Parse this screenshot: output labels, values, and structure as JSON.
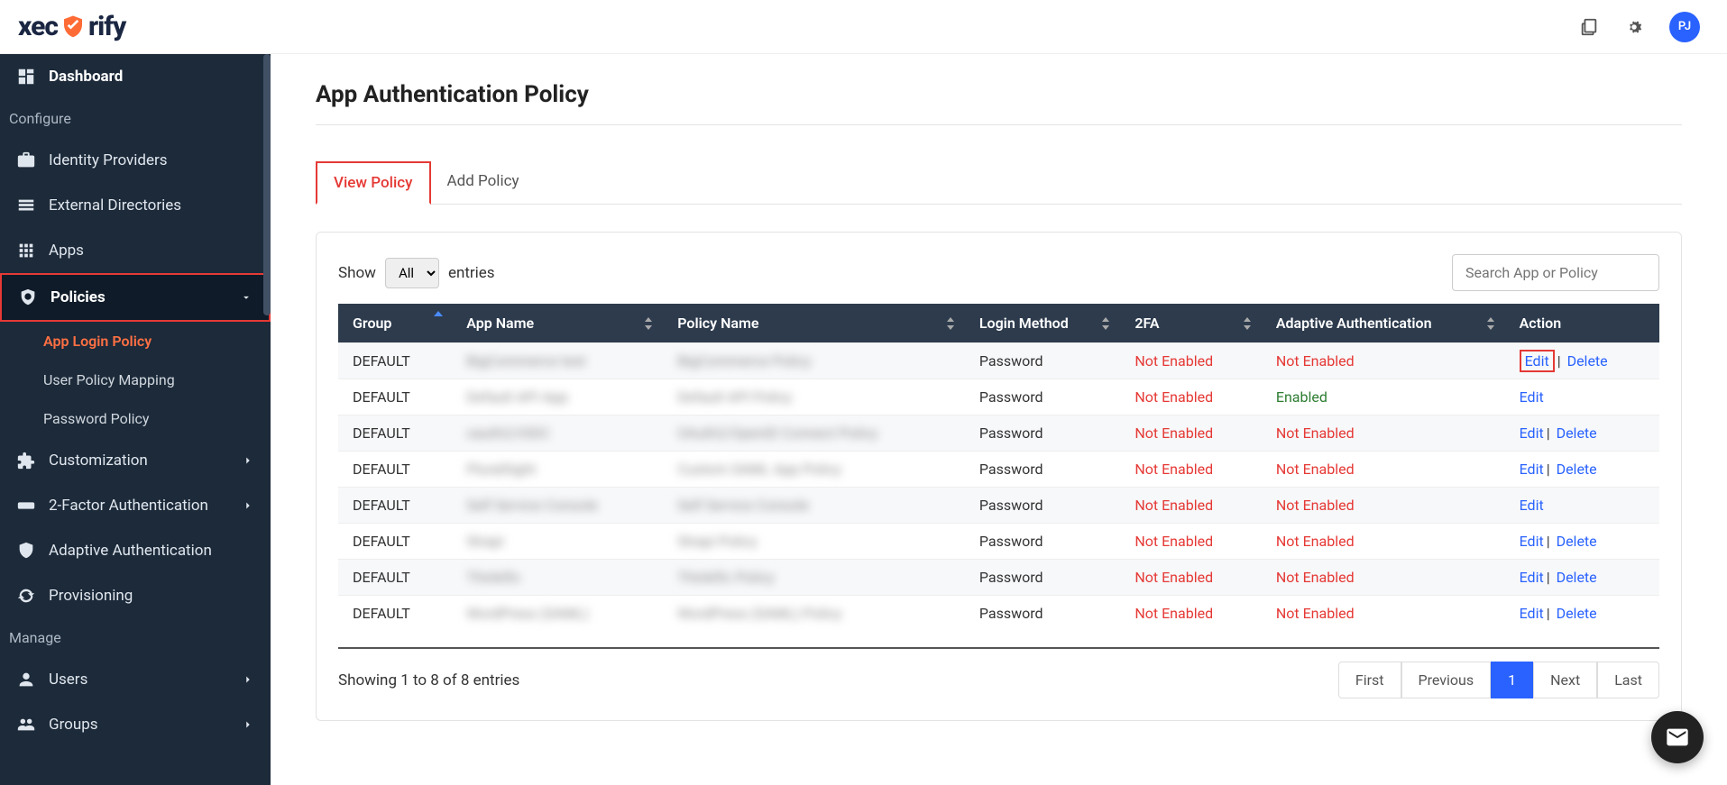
{
  "header": {
    "logo_pre": "xec",
    "logo_post": "rify",
    "avatar": "PJ"
  },
  "sidebar": {
    "dashboard": "Dashboard",
    "section_configure": "Configure",
    "identity_providers": "Identity Providers",
    "external_directories": "External Directories",
    "apps": "Apps",
    "policies": "Policies",
    "sub_app_login": "App Login Policy",
    "sub_user_policy": "User Policy Mapping",
    "sub_password": "Password Policy",
    "customization": "Customization",
    "two_factor": "2-Factor Authentication",
    "adaptive_auth": "Adaptive Authentication",
    "provisioning": "Provisioning",
    "section_manage": "Manage",
    "users": "Users",
    "groups": "Groups"
  },
  "main": {
    "title": "App Authentication Policy",
    "tabs": {
      "view": "View Policy",
      "add": "Add Policy"
    },
    "controls": {
      "show_label": "Show",
      "entries_label": "entries",
      "select_value": "All",
      "search_placeholder": "Search App or Policy"
    },
    "columns": {
      "group": "Group",
      "app_name": "App Name",
      "policy_name": "Policy Name",
      "login_method": "Login Method",
      "twofa": "2FA",
      "adaptive": "Adaptive Authentication",
      "action": "Action"
    },
    "rows": [
      {
        "group": "DEFAULT",
        "app": "BigCommerce test",
        "policy": "BigCommerce Policy",
        "login": "Password",
        "tfa": "Not Enabled",
        "adaptive": "Not Enabled",
        "edit": "Edit",
        "delete": "Delete",
        "boxed": true
      },
      {
        "group": "DEFAULT",
        "app": "Default API App",
        "policy": "Default API Policy",
        "login": "Password",
        "tfa": "Not Enabled",
        "adaptive": "Enabled",
        "edit": "Edit",
        "delete": ""
      },
      {
        "group": "DEFAULT",
        "app": "oauth2/OIDC",
        "policy": "OAuth2/OpenID Connect Policy",
        "login": "Password",
        "tfa": "Not Enabled",
        "adaptive": "Not Enabled",
        "edit": "Edit",
        "delete": "Delete"
      },
      {
        "group": "DEFAULT",
        "app": "PluralSight",
        "policy": "Custom SAML App Policy",
        "login": "Password",
        "tfa": "Not Enabled",
        "adaptive": "Not Enabled",
        "edit": "Edit",
        "delete": "Delete"
      },
      {
        "group": "DEFAULT",
        "app": "Self Service Console",
        "policy": "Self Service Console",
        "login": "Password",
        "tfa": "Not Enabled",
        "adaptive": "Not Enabled",
        "edit": "Edit",
        "delete": ""
      },
      {
        "group": "DEFAULT",
        "app": "Strapi",
        "policy": "Strapi Policy",
        "login": "Password",
        "tfa": "Not Enabled",
        "adaptive": "Not Enabled",
        "edit": "Edit",
        "delete": "Delete"
      },
      {
        "group": "DEFAULT",
        "app": "Thinkific",
        "policy": "Thinkific Policy",
        "login": "Password",
        "tfa": "Not Enabled",
        "adaptive": "Not Enabled",
        "edit": "Edit",
        "delete": "Delete"
      },
      {
        "group": "DEFAULT",
        "app": "WordPress (SAML)",
        "policy": "WordPress (SAML) Policy",
        "login": "Password",
        "tfa": "Not Enabled",
        "adaptive": "Not Enabled",
        "edit": "Edit",
        "delete": "Delete"
      }
    ],
    "footer_info": "Showing 1 to 8 of 8 entries",
    "pagination": {
      "first": "First",
      "prev": "Previous",
      "p1": "1",
      "next": "Next",
      "last": "Last"
    },
    "action_sep": "|"
  }
}
